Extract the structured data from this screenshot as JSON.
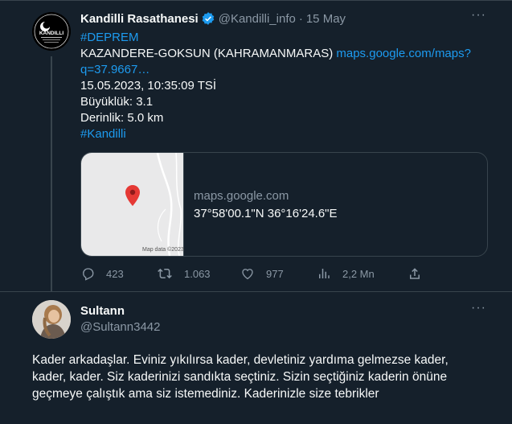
{
  "tweet": {
    "author_name": "Kandilli Rasathanesi",
    "handle": "@Kandilli_info",
    "sep": "·",
    "date": "15 May",
    "avatar_text": "KANDILLI",
    "hashtag1": "#DEPREM",
    "location": "KAZANDERE-GOKSUN (KAHRAMANMARAS)",
    "link_part1": "maps.google.com/maps?",
    "link_part2": "q=37.9667…",
    "datetime": "15.05.2023, 10:35:09 TSİ",
    "magnitude": "Büyüklük: 3.1",
    "depth": "Derinlik: 5.0 km",
    "hashtag2": "#Kandilli",
    "card": {
      "domain": "maps.google.com",
      "coords": "37°58'00.1\"N 36°16'24.6\"E",
      "map_credit": "Map data ©2023"
    },
    "actions": {
      "replies": "423",
      "retweets": "1.063",
      "likes": "977",
      "views": "2,2 Mn"
    }
  },
  "reply": {
    "author_name": "Sultann",
    "handle": "@Sultann3442",
    "text": "Kader arkadaşlar. Eviniz yıkılırsa kader, devletiniz yardıma gelmezse kader, kader, kader. Siz kaderinizi sandıkta seçtiniz. Sizin seçtiğiniz kaderin önüne geçmeye çalıştık ama siz istemediniz. Kaderinizle size tebrikler"
  },
  "colors": {
    "background": "#15202b",
    "link": "#1d9bf0",
    "muted": "#8b98a5",
    "verified": "#1d9bf0",
    "pin": "#e53935"
  },
  "icons": [
    "verified-badge-icon",
    "more-icon",
    "map-pin-icon",
    "reply-icon",
    "retweet-icon",
    "like-icon",
    "views-icon",
    "share-icon"
  ]
}
